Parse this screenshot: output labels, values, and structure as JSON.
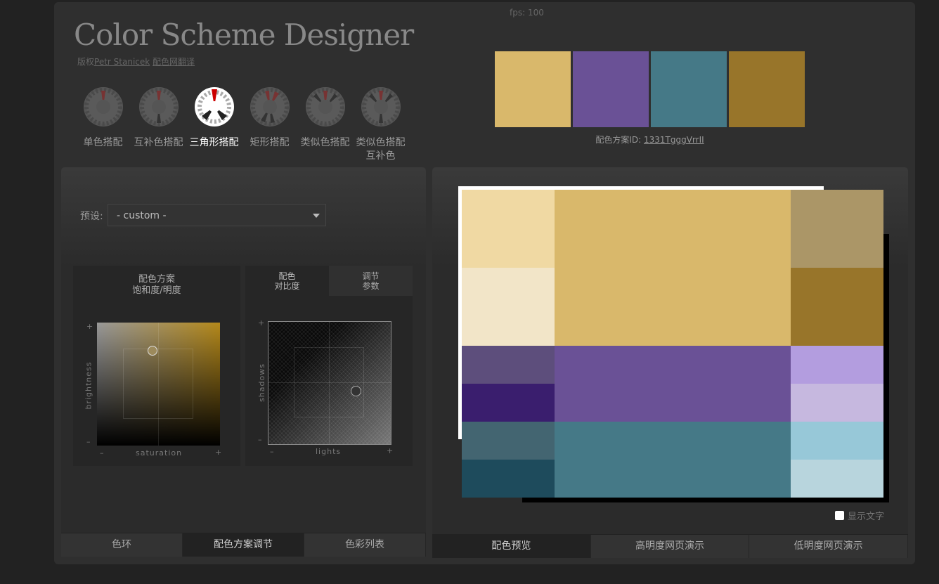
{
  "fps": "fps: 100",
  "logo": "Color Scheme Designer",
  "credit": {
    "prefix": "版权",
    "author": "Petr Stanicek",
    "translator": "配色网翻译"
  },
  "modes": [
    {
      "label": "单色搭配"
    },
    {
      "label": "互补色搭配"
    },
    {
      "label": "三角形搭配"
    },
    {
      "label": "矩形搭配"
    },
    {
      "label": "类似色搭配"
    },
    {
      "label": "类似色搭配互补色"
    }
  ],
  "active_mode_index": 2,
  "palette": [
    "#d9b86b",
    "#6a5196",
    "#457987",
    "#98752a"
  ],
  "scheme": {
    "label": "配色方案ID: ",
    "id": "1331TgggVrrII"
  },
  "preset": {
    "label": "预设:",
    "value": "- custom -"
  },
  "sat_panel": {
    "title_line1": "配色方案",
    "title_line2": "饱和度/明度",
    "xlabel": "saturation",
    "ylabel": "brightness",
    "plus": "+",
    "minus": "–"
  },
  "contrast_panel": {
    "tab1_line1": "配色",
    "tab1_line2": "对比度",
    "tab2_line1": "调节",
    "tab2_line2": "参数",
    "xlabel": "lights",
    "ylabel": "shadows"
  },
  "left_tabs": [
    "色环",
    "配色方案调节",
    "色彩列表"
  ],
  "left_active_tab": 1,
  "right_tabs": [
    "配色预览",
    "高明度网页演示",
    "低明度网页演示"
  ],
  "show_text": "显示文字",
  "preview_colors": {
    "primary": [
      "#f0d9a3",
      "#f2e5c8",
      "#d9b86b",
      "#ab9667",
      "#98752a"
    ],
    "second": [
      "#5d4e7c",
      "#3a1e6e",
      "#6a5196",
      "#b39ddf",
      "#c6b8df"
    ],
    "third": [
      "#436571",
      "#1e4b5c",
      "#457987",
      "#97c8d8",
      "#b8d5dd"
    ]
  }
}
